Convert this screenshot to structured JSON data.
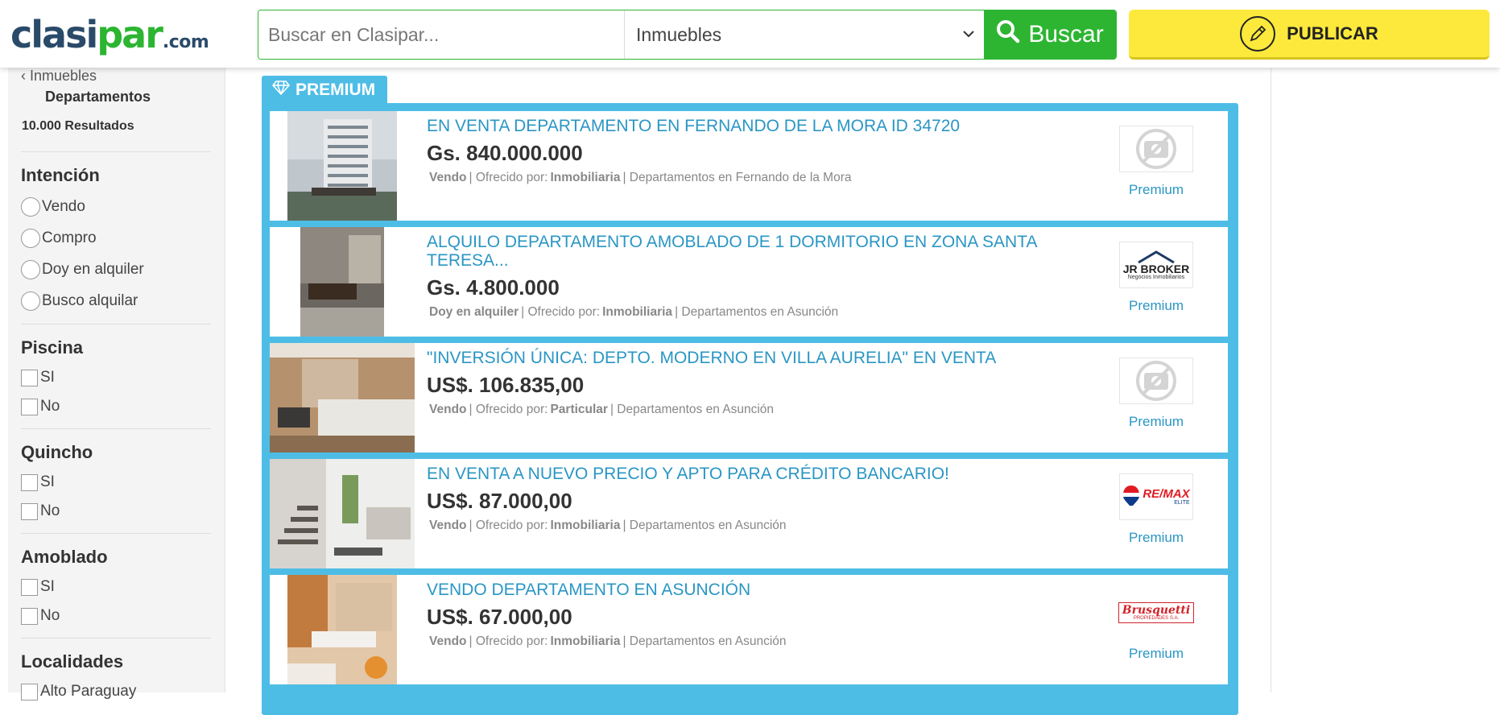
{
  "header": {
    "logo": {
      "part1": "clasi",
      "part2": "par",
      "part3": ".com"
    },
    "search_placeholder": "Buscar en Clasipar...",
    "category": "Inmuebles",
    "search_label": "Buscar",
    "publish_label": "PUBLICAR"
  },
  "sidebar": {
    "back_label": "Inmuebles",
    "current": "Departamentos",
    "results": "10.000 Resultados",
    "groups": [
      {
        "title": "Intención",
        "options": [
          "Vendo",
          "Compro",
          "Doy en alquiler",
          "Busco alquilar"
        ]
      },
      {
        "title": "Piscina",
        "options": [
          "SI",
          "No"
        ]
      },
      {
        "title": "Quincho",
        "options": [
          "SI",
          "No"
        ]
      },
      {
        "title": "Amoblado",
        "options": [
          "SI",
          "No"
        ]
      },
      {
        "title": "Localidades",
        "options": [
          "Alto Paraguay"
        ]
      }
    ]
  },
  "main": {
    "premium_label": "PREMIUM",
    "listings": [
      {
        "title": "EN VENTA DEPARTAMENTO EN FERNANDO DE LA MORA ID 34720",
        "price": "Gs. 840.000.000",
        "intent": "Vendo",
        "offered_label": "| Ofrecido por:",
        "offered_by": "Inmobiliaria",
        "location": "| Departamentos en Fernando de la Mora",
        "badge": "Premium",
        "logo_icon": "no-photo-icon"
      },
      {
        "title": "ALQUILO DEPARTAMENTO AMOBLADO DE 1 DORMITORIO EN ZONA SANTA TERESA...",
        "price": "Gs. 4.800.000",
        "intent": "Doy en alquiler",
        "offered_label": "| Ofrecido por:",
        "offered_by": "Inmobiliaria",
        "location": "| Departamentos en Asunción",
        "badge": "Premium",
        "logo_text": "JR BROKER",
        "logo_sub": "Negocios Inmobiliarios"
      },
      {
        "title": "\"INVERSIÓN ÚNICA: DEPTO. MODERNO EN VILLA AURELIA\" EN VENTA",
        "price": "US$. 106.835,00",
        "intent": "Vendo",
        "offered_label": "| Ofrecido por:",
        "offered_by": "Particular",
        "location": "| Departamentos en Asunción",
        "badge": "Premium",
        "logo_icon": "no-photo-icon"
      },
      {
        "title": "EN VENTA A NUEVO PRECIO Y APTO PARA CRÉDITO BANCARIO!",
        "price": "US$. 87.000,00",
        "intent": "Vendo",
        "offered_label": "| Ofrecido por:",
        "offered_by": "Inmobiliaria",
        "location": "| Departamentos en Asunción",
        "badge": "Premium",
        "logo_text": "RE/MAX",
        "logo_sub": "ELITE"
      },
      {
        "title": "VENDO DEPARTAMENTO EN ASUNCIÓN",
        "price": "US$. 67.000,00",
        "intent": "Vendo",
        "offered_label": "| Ofrecido por:",
        "offered_by": "Inmobiliaria",
        "location": "| Departamentos en Asunción",
        "badge": "Premium",
        "logo_text": "Brusquetti",
        "logo_sub": "PROPIEDADES S.A."
      }
    ]
  },
  "colors": {
    "brand_green": "#2db532",
    "brand_dark": "#2a4a6a",
    "premium_blue": "#4ebde6",
    "link_blue": "#2a96c4",
    "publish_yellow": "#fce93c"
  }
}
